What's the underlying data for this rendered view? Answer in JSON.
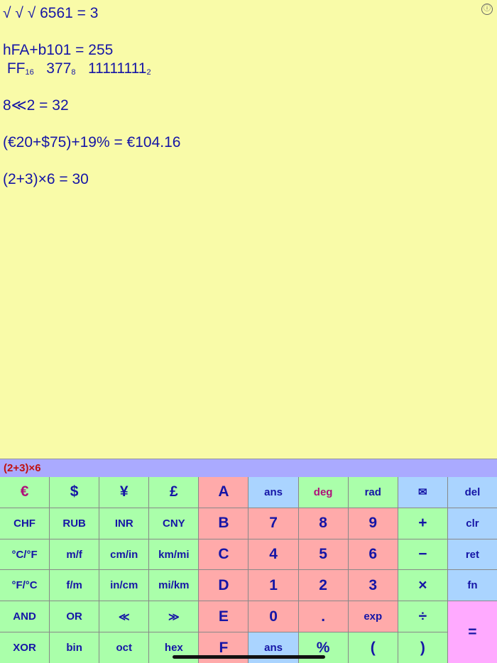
{
  "history": [
    {
      "text": "√ √ √ 6561 = 3"
    },
    {
      "gap": true
    },
    {
      "text": "hFA+b101 = 255"
    },
    {
      "bases": [
        {
          "v": "FF",
          "b": "16"
        },
        {
          "v": "377",
          "b": "8"
        },
        {
          "v": "11111111",
          "b": "2"
        }
      ]
    },
    {
      "gap": true
    },
    {
      "text": "8≪2 = 32"
    },
    {
      "gap": true
    },
    {
      "text": "(€20+$75)+19% = €104.16"
    },
    {
      "gap": true
    },
    {
      "text": "(2+3)×6 = 30"
    }
  ],
  "info_icon": "ⓘ",
  "input": {
    "expression": "(2+3)×6"
  },
  "colors": {
    "background": "#f9fba8",
    "green": "#aaffaa",
    "red": "#ffaaaa",
    "blue": "#aad4ff",
    "input_bar": "#aaaaff",
    "equals": "#ffaaff",
    "text": "#1515a6"
  },
  "keys": [
    {
      "l": "€",
      "c": "g",
      "big": 1,
      "m": 1
    },
    {
      "l": "$",
      "c": "g",
      "big": 1
    },
    {
      "l": "¥",
      "c": "g",
      "big": 1
    },
    {
      "l": "£",
      "c": "g",
      "big": 1
    },
    {
      "l": "A",
      "c": "r",
      "big": 1
    },
    {
      "l": "ans",
      "c": "b"
    },
    {
      "l": "deg",
      "c": "g",
      "m": 1
    },
    {
      "l": "rad",
      "c": "g"
    },
    {
      "l": "✉",
      "c": "b",
      "name": "mail"
    },
    {
      "l": "del",
      "c": "b"
    },
    {
      "l": "CHF",
      "c": "g"
    },
    {
      "l": "RUB",
      "c": "g"
    },
    {
      "l": "INR",
      "c": "g"
    },
    {
      "l": "CNY",
      "c": "g"
    },
    {
      "l": "B",
      "c": "r",
      "big": 1
    },
    {
      "l": "7",
      "c": "r",
      "big": 1
    },
    {
      "l": "8",
      "c": "r",
      "big": 1
    },
    {
      "l": "9",
      "c": "r",
      "big": 1
    },
    {
      "l": "+",
      "c": "g",
      "big": 1,
      "name": "plus"
    },
    {
      "l": "clr",
      "c": "b"
    },
    {
      "l": "°C/°F",
      "c": "g"
    },
    {
      "l": "m/f",
      "c": "g"
    },
    {
      "l": "cm/in",
      "c": "g"
    },
    {
      "l": "km/mi",
      "c": "g"
    },
    {
      "l": "C",
      "c": "r",
      "big": 1
    },
    {
      "l": "4",
      "c": "r",
      "big": 1
    },
    {
      "l": "5",
      "c": "r",
      "big": 1
    },
    {
      "l": "6",
      "c": "r",
      "big": 1
    },
    {
      "l": "−",
      "c": "g",
      "big": 1,
      "name": "minus"
    },
    {
      "l": "ret",
      "c": "b"
    },
    {
      "l": "°F/°C",
      "c": "g"
    },
    {
      "l": "f/m",
      "c": "g"
    },
    {
      "l": "in/cm",
      "c": "g"
    },
    {
      "l": "mi/km",
      "c": "g"
    },
    {
      "l": "D",
      "c": "r",
      "big": 1
    },
    {
      "l": "1",
      "c": "r",
      "big": 1
    },
    {
      "l": "2",
      "c": "r",
      "big": 1
    },
    {
      "l": "3",
      "c": "r",
      "big": 1
    },
    {
      "l": "×",
      "c": "g",
      "big": 1,
      "name": "multiply"
    },
    {
      "l": "fn",
      "c": "b"
    },
    {
      "l": "AND",
      "c": "g"
    },
    {
      "l": "OR",
      "c": "g"
    },
    {
      "l": "≪",
      "c": "g",
      "name": "shift-left"
    },
    {
      "l": "≫",
      "c": "g",
      "name": "shift-right"
    },
    {
      "l": "E",
      "c": "r",
      "big": 1
    },
    {
      "l": "0",
      "c": "r",
      "big": 1
    },
    {
      "l": ".",
      "c": "r",
      "big": 1,
      "name": "decimal"
    },
    {
      "l": "exp",
      "c": "r"
    },
    {
      "l": "÷",
      "c": "g",
      "big": 1,
      "name": "divide"
    },
    {
      "l": "=",
      "c": "p",
      "big": 1,
      "name": "equals",
      "span": 2
    },
    {
      "l": "XOR",
      "c": "g"
    },
    {
      "l": "bin",
      "c": "g"
    },
    {
      "l": "oct",
      "c": "g"
    },
    {
      "l": "hex",
      "c": "g"
    },
    {
      "l": "F",
      "c": "r",
      "big": 1
    },
    {
      "l": "ans",
      "c": "b"
    },
    {
      "l": "%",
      "c": "g",
      "big": 1,
      "name": "percent"
    },
    {
      "l": "(",
      "c": "g",
      "big": 1,
      "name": "open-paren"
    },
    {
      "l": ")",
      "c": "g",
      "big": 1,
      "name": "close-paren"
    }
  ]
}
